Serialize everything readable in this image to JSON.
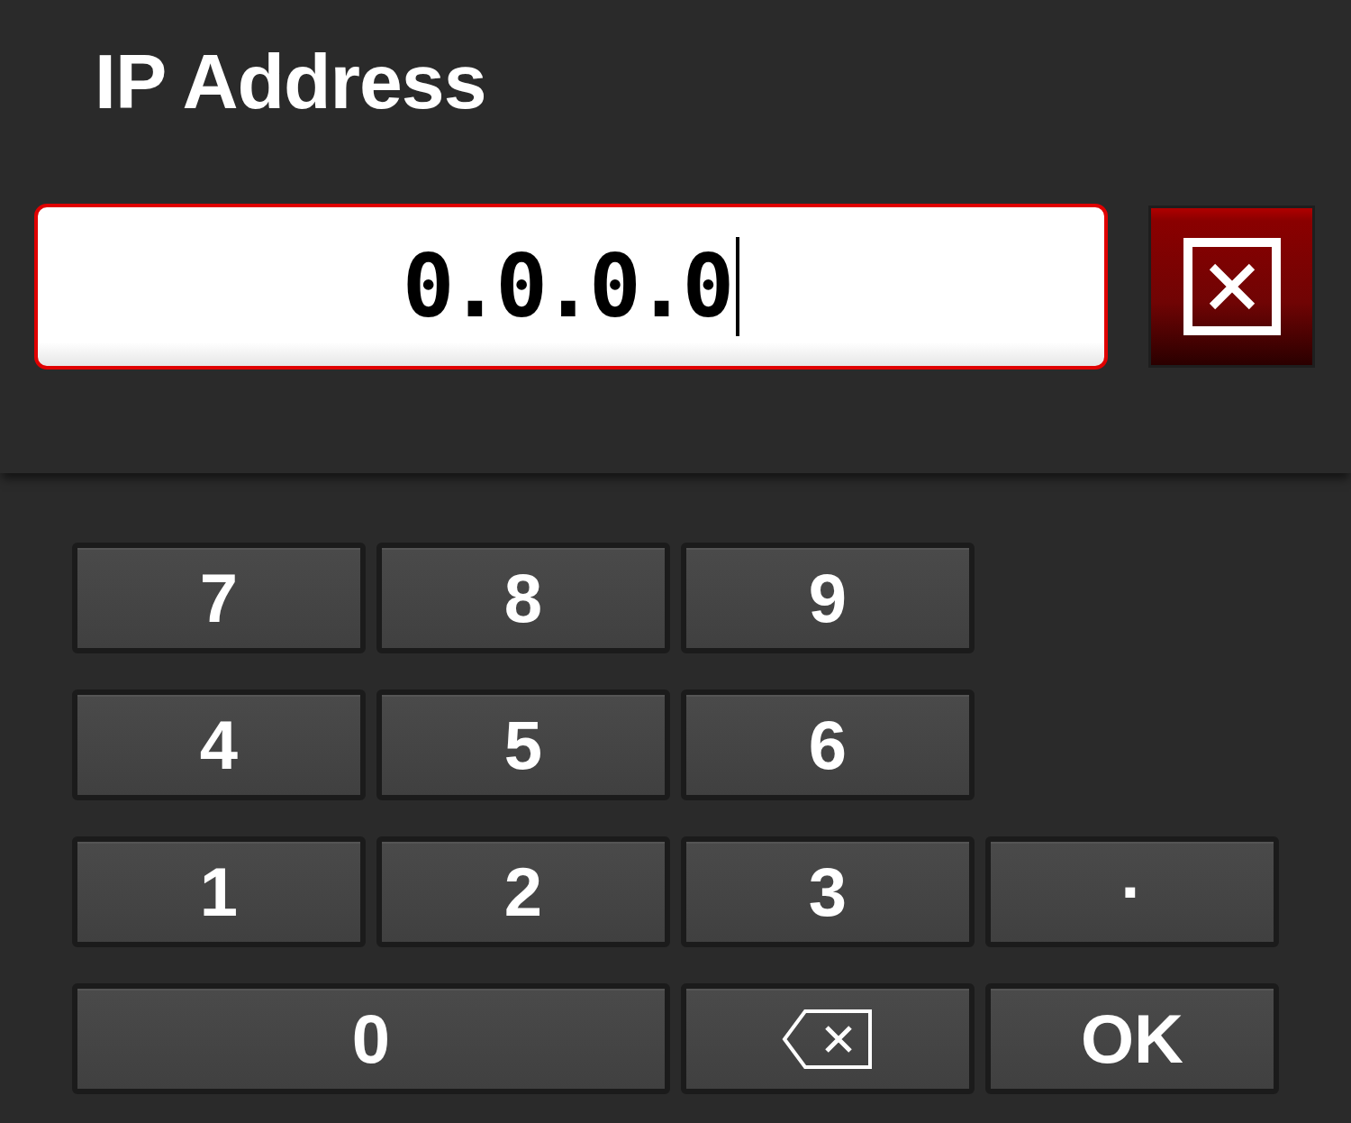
{
  "title": "IP Address",
  "field": {
    "value": "0.0.0.0",
    "focused": true
  },
  "clear_button": {
    "kind": "clear"
  },
  "keypad": {
    "rows": [
      [
        {
          "label": "7",
          "kind": "digit",
          "wide": false
        },
        {
          "label": "8",
          "kind": "digit",
          "wide": false
        },
        {
          "label": "9",
          "kind": "digit",
          "wide": false
        }
      ],
      [
        {
          "label": "4",
          "kind": "digit",
          "wide": false
        },
        {
          "label": "5",
          "kind": "digit",
          "wide": false
        },
        {
          "label": "6",
          "kind": "digit",
          "wide": false
        }
      ],
      [
        {
          "label": "1",
          "kind": "digit",
          "wide": false
        },
        {
          "label": "2",
          "kind": "digit",
          "wide": false
        },
        {
          "label": "3",
          "kind": "digit",
          "wide": false
        },
        {
          "label": "·",
          "kind": "digit",
          "wide": false
        }
      ],
      [
        {
          "label": "0",
          "kind": "digit",
          "wide": true,
          "colspan": 2
        },
        {
          "kind": "backspace",
          "wide": false
        },
        {
          "label": "OK",
          "kind": "ok",
          "wide": false
        }
      ]
    ]
  }
}
